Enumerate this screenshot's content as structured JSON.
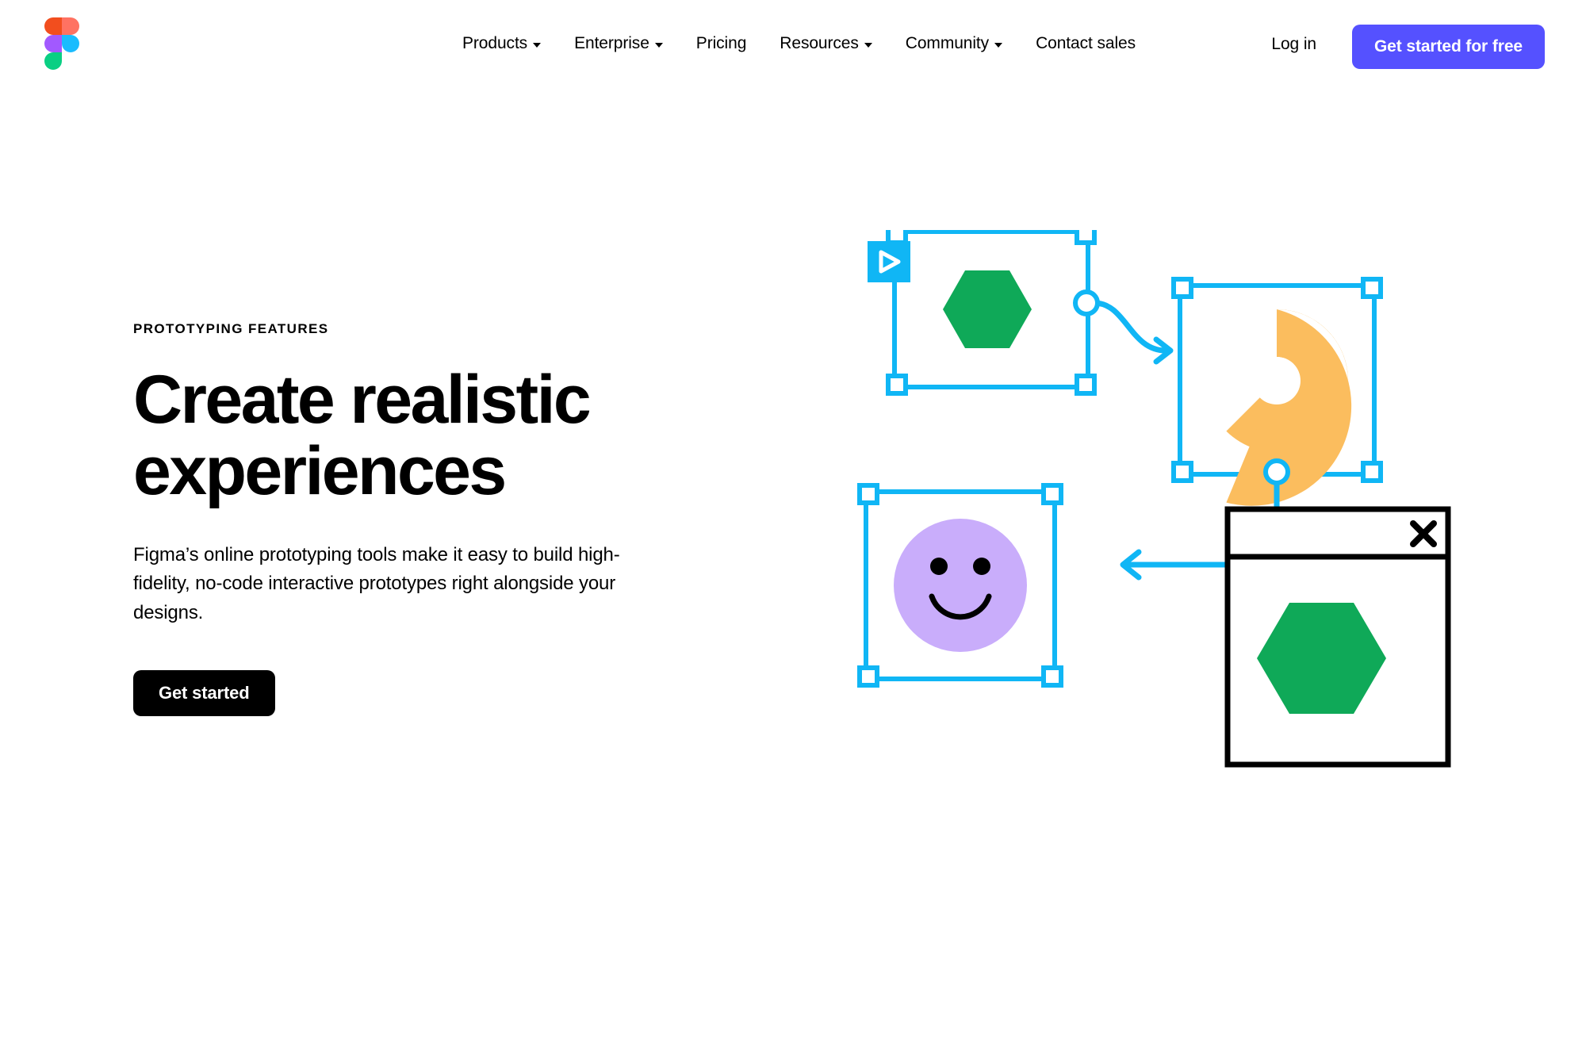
{
  "brand": {
    "logo_icon": "figma-logo",
    "colors": {
      "accent_purple": "#5551FF",
      "logo_red": "#F24E1E",
      "logo_salmon": "#FF7262",
      "logo_purple": "#A259FF",
      "logo_blue": "#1ABCFE",
      "logo_green": "#0ACF83",
      "selection_blue": "#10B6F5",
      "shape_green": "#0FA958",
      "shape_orange": "#FBBD5E",
      "shape_lavender": "#C9ADFB",
      "button_dark": "#000000",
      "page_bg": "#FFFFFF"
    }
  },
  "header": {
    "nav_items": [
      {
        "label": "Products",
        "has_dropdown": true
      },
      {
        "label": "Enterprise",
        "has_dropdown": true
      },
      {
        "label": "Pricing",
        "has_dropdown": false
      },
      {
        "label": "Resources",
        "has_dropdown": true
      },
      {
        "label": "Community",
        "has_dropdown": true
      },
      {
        "label": "Contact sales",
        "has_dropdown": false
      }
    ],
    "login_label": "Log in",
    "cta_label": "Get started for free"
  },
  "hero": {
    "eyebrow": "PROTOTYPING FEATURES",
    "headline": "Create realistic experiences",
    "body": "Figma’s online prototyping tools make it easy to build high-fidelity, no-code interactive prototypes right alongside your designs.",
    "cta_label": "Get started"
  },
  "illustration": {
    "description": "Prototyping canvas with three selected frames connected by interaction arrows and a modal overlay",
    "nodes": [
      {
        "name": "hexagon-frame",
        "shape": "hexagon",
        "color": "#0FA958",
        "badge": "play-icon",
        "selected": true
      },
      {
        "name": "arc-frame",
        "shape": "arc",
        "color": "#FBBD5E",
        "selected": true
      },
      {
        "name": "smiley-frame",
        "shape": "smiley",
        "color": "#C9ADFB",
        "selected": true
      },
      {
        "name": "modal-window",
        "shape": "modal",
        "color": "#0FA958",
        "close_icon": "close-x-icon"
      }
    ],
    "connectors": [
      {
        "from": "hexagon-frame",
        "to": "arc-frame",
        "style": "curved-arrow"
      },
      {
        "from": "arc-frame",
        "to": "modal-window",
        "style": "straight-line"
      },
      {
        "from": "modal-window",
        "to": "smiley-frame",
        "style": "straight-arrow"
      }
    ]
  }
}
